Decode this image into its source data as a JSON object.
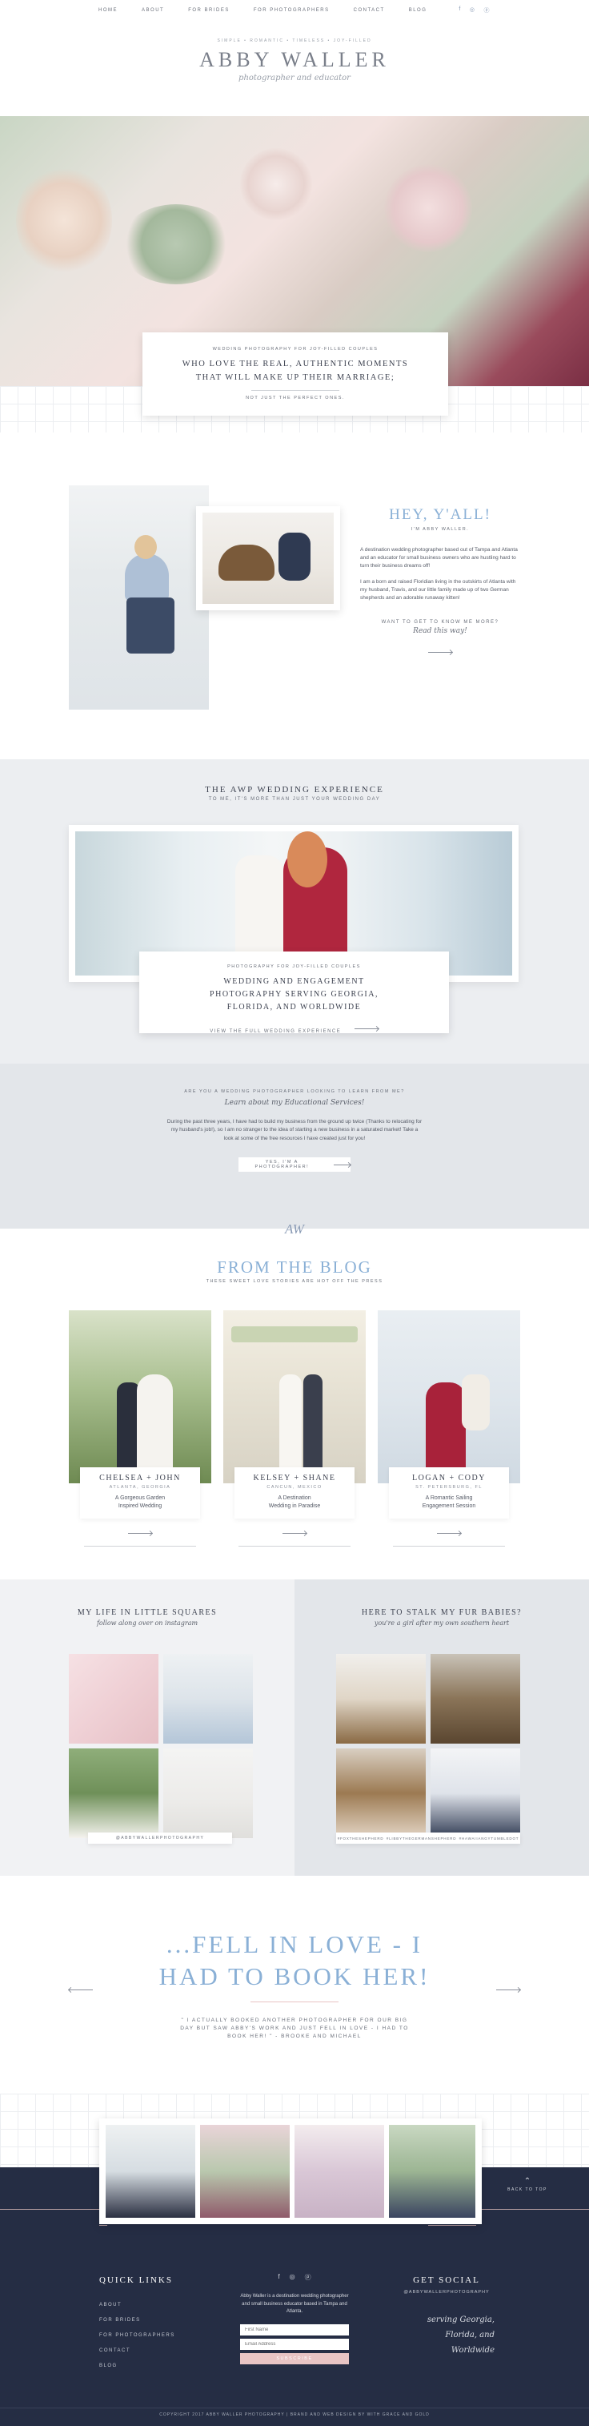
{
  "nav": {
    "items": [
      "HOME",
      "ABOUT",
      "FOR BRIDES",
      "FOR PHOTOGRAPHERS",
      "CONTACT",
      "BLOG"
    ],
    "icons": [
      "facebook-icon",
      "instagram-icon",
      "pinterest-icon"
    ]
  },
  "brand": {
    "tagline_top": "SIMPLE • ROMANTIC • TIMELESS • JOY-FILLED",
    "name": "ABBY WALLER",
    "subtitle": "photographer and educator"
  },
  "hero": {
    "eyebrow": "WEDDING PHOTOGRAPHY FOR JOY-FILLED COUPLES",
    "headline": "WHO LOVE THE REAL, AUTHENTIC MOMENTS THAT WILL MAKE UP THEIR MARRIAGE;",
    "sub": "NOT JUST THE PERFECT ONES."
  },
  "about": {
    "title": "HEY, Y'ALL!",
    "subtitle": "I'M ABBY WALLER.",
    "para1": "A destination wedding photographer based out of Tampa and Atlanta and an educator for small business owners who are hustling hard to turn their business dreams off!",
    "para2": "I am a born and raised Floridian living in the outskirts of Atlanta with my husband, Travis, and our little family made up of two German shepherds and an adorable runaway kitten!",
    "cta": "WANT TO GET TO KNOW ME MORE?",
    "cta_script": "Read this way!"
  },
  "experience": {
    "title": "THE AWP WEDDING EXPERIENCE",
    "subtitle": "TO ME, IT'S MORE THAN JUST YOUR WEDDING DAY",
    "card_eyebrow": "PHOTOGRAPHY FOR JOY-FILLED COUPLES",
    "card_title": "WEDDING AND ENGAGEMENT PHOTOGRAPHY SERVING GEORGIA, FLORIDA, AND WORLDWIDE",
    "card_cta": "VIEW THE FULL WEDDING EXPERIENCE"
  },
  "education": {
    "eyebrow": "ARE YOU A WEDDING PHOTOGRAPHER LOOKING TO LEARN FROM ME?",
    "script": "Learn about my Educational Services!",
    "body": "During the past three years, I have had to build my business from the ground up twice (Thanks to relocating for my husband's job!), so I am no stranger to the idea of starting a new business in a saturated market! Take a look at some of the free resources I have created just for you!",
    "button": "YES, I'M A PHOTOGRAPHER!"
  },
  "monogram": "AW",
  "blog": {
    "title": "FROM THE BLOG",
    "subtitle": "THESE SWEET LOVE STORIES ARE HOT OFF THE PRESS",
    "posts": [
      {
        "title": "CHELSEA + JOHN",
        "location": "ATLANTA, GEORGIA",
        "desc1": "A Gorgeous Garden",
        "desc2": "Inspired Wedding"
      },
      {
        "title": "KELSEY + SHANE",
        "location": "CANCUN, MEXICO",
        "desc1": "A Destination",
        "desc2": "Wedding in Paradise"
      },
      {
        "title": "LOGAN + CODY",
        "location": "ST. PETERSBURG, FL",
        "desc1": "A Romantic Sailing",
        "desc2": "Engagement Session"
      }
    ]
  },
  "instagram": {
    "title": "MY LIFE IN LITTLE SQUARES",
    "script": "follow along over on instagram",
    "handle": "@ABBYWALLERPHOTOGRAPHY"
  },
  "furbabies": {
    "title": "HERE TO STALK MY FUR BABIES?",
    "script": "you're a girl after my own southern heart",
    "tags": [
      "#FOXTHESHEPHERD",
      "#LIBBYTHEGERMANSHEPHERD",
      "#HAWAIIANGYTUMBLEDOT"
    ]
  },
  "testimonial": {
    "headline": "...FELL IN LOVE - I HAD TO BOOK HER!",
    "quote": "\" I ACTUALLY BOOKED ANOTHER PHOTOGRAPHER FOR OUR BIG DAY BUT SAW ABBY'S WORK AND JUST FELL IN LOVE - I HAD TO BOOK HER! \" - BROOKE AND MICHAEL"
  },
  "back_to_top": "BACK TO TOP",
  "footer": {
    "quick_links_title": "QUICK LINKS",
    "links": [
      "ABOUT",
      "FOR BRIDES",
      "FOR PHOTOGRAPHERS",
      "CONTACT",
      "BLOG"
    ],
    "bio": "Abby Waller is a destination wedding photographer and small business educator based in Tampa and Atlanta.",
    "first_name_placeholder": "First Name",
    "email_placeholder": "Email Address",
    "subscribe": "SUBSCRIBE",
    "social_title": "GET SOCIAL",
    "social_handle": "@ABBYWALLERPHOTOGRAPHY",
    "script_line1": "serving Georgia,",
    "script_line2": "Florida, and",
    "script_line3": "Worldwide",
    "copyright": "COPYRIGHT 2017 ABBY WALLER PHOTOGRAPHY | BRAND AND WEB DESIGN BY WITH GRACE AND GOLD"
  },
  "colors": {
    "accent_blue": "#8ab0d6",
    "navy": "#252d44",
    "blush": "#e8c4c4",
    "gray_bg": "#eceef1"
  }
}
